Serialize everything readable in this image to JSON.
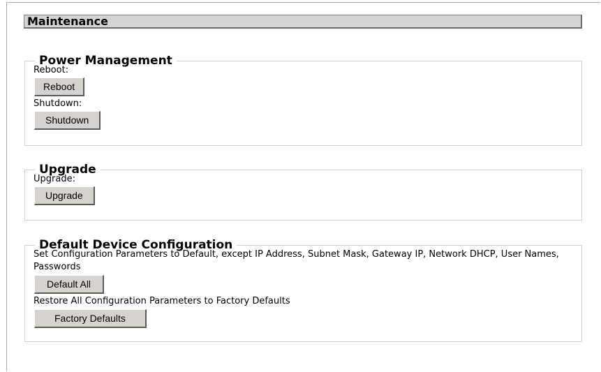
{
  "page": {
    "title": "Maintenance"
  },
  "power": {
    "legend": "Power Management",
    "reboot_label": "Reboot:",
    "reboot_button": "Reboot",
    "shutdown_label": "Shutdown:",
    "shutdown_button": "Shutdown"
  },
  "upgrade": {
    "legend": "Upgrade",
    "upgrade_label": "Upgrade:",
    "upgrade_button": "Upgrade"
  },
  "defaults": {
    "legend": "Default Device Configuration",
    "default_all_text": "Set Configuration Parameters to Default, except IP Address, Subnet Mask, Gateway IP, Network DHCP, User Names, Passwords",
    "default_all_button": "Default All",
    "factory_text": "Restore All Configuration Parameters to Factory Defaults",
    "factory_button": "Factory Defaults"
  }
}
